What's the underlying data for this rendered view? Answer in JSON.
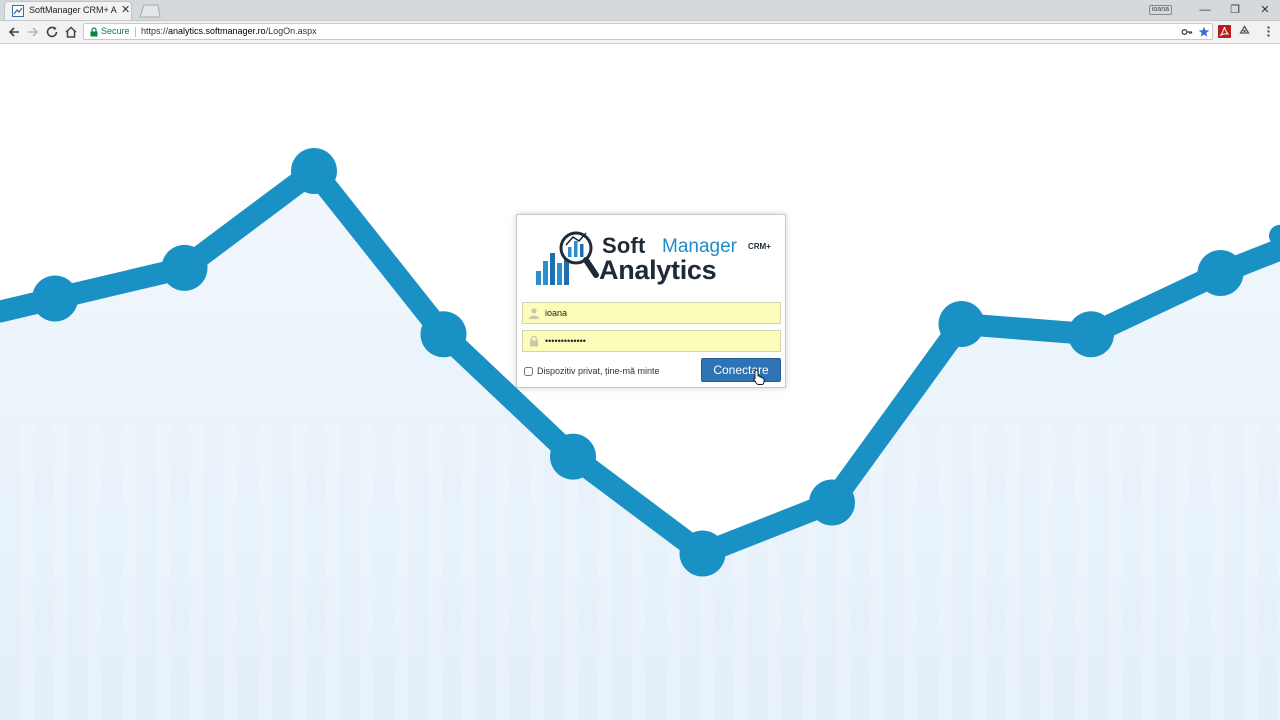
{
  "browser": {
    "tab_title": "SoftManager CRM+ Analytics",
    "tab_close": "✕",
    "profile_label": "ioana",
    "window_controls": [
      "—",
      "❐",
      "✕"
    ],
    "secure_label": "Secure",
    "url_scheme": "https://",
    "url_host": "analytics.softmanager.ro",
    "url_path": "/LogOn.aspx"
  },
  "login": {
    "brand_soft": "Soft",
    "brand_manager": "Manager",
    "brand_crm": "CRM+",
    "brand_analytics": "Analytics",
    "username_value": "ioana",
    "password_value": "•••••••••••••",
    "remember_label": "Dispozitiv privat, ține-mă minte",
    "remember_checked": false,
    "submit_label": "Conectare"
  },
  "background_chart": {
    "type": "line",
    "values": [
      65,
      71,
      90,
      58,
      34,
      15,
      25,
      60,
      58,
      70,
      80,
      85
    ],
    "line_color": "#1a91c4",
    "fill_color": "#e8f2fa"
  },
  "colors": {
    "accent": "#2e73b4",
    "brand_blue": "#1e8cc8",
    "autofill": "#fbfdb9"
  }
}
